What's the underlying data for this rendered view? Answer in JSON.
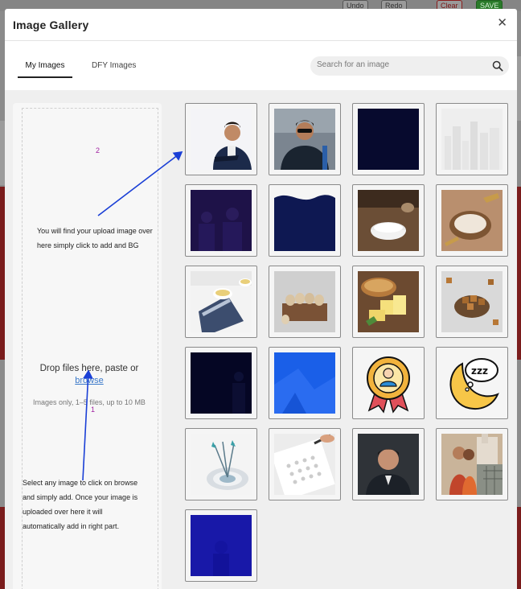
{
  "background": {
    "toolbar": {
      "undo": "Undo",
      "redo": "Redo",
      "clear": "Clear",
      "save": "SAVE"
    }
  },
  "modal": {
    "title": "Image Gallery",
    "close_icon": "close-icon",
    "tabs": [
      {
        "label": "My Images",
        "active": true
      },
      {
        "label": "DFY Images",
        "active": false
      }
    ],
    "search": {
      "placeholder": "Search for an image",
      "value": "",
      "icon": "search-icon"
    }
  },
  "upload": {
    "drop_text": "Drop files here, paste or",
    "browse_label": "browse",
    "hint": "Images only, 1–5 files, up to 10 MB"
  },
  "annotations": {
    "note_top": [
      "You will find your upload image over",
      "here simply click to add and BG"
    ],
    "note_bottom": [
      "Select any image to click on browse",
      "and simply add. Once your image is",
      "uploaded over here it will",
      "automatically add in right part."
    ],
    "marker_2": "2",
    "marker_1": "1"
  },
  "gallery": {
    "tiles": [
      {
        "id": "man-suit-cutout"
      },
      {
        "id": "man-jacket-sunglasses"
      },
      {
        "id": "dark-navy-square"
      },
      {
        "id": "city-skyline-faded"
      },
      {
        "id": "purple-crowd-overlay"
      },
      {
        "id": "navy-wave-shape"
      },
      {
        "id": "salt-bowl"
      },
      {
        "id": "flour-bowl-wheat"
      },
      {
        "id": "tea-cups-napkin"
      },
      {
        "id": "eggs-in-crate"
      },
      {
        "id": "bread-and-butter"
      },
      {
        "id": "brown-sugar-cubes"
      },
      {
        "id": "dark-crowd-silhouette"
      },
      {
        "id": "blue-abstract"
      },
      {
        "id": "employee-award-badge-icon"
      },
      {
        "id": "moon-zzz-sleep-icon"
      },
      {
        "id": "target-arrows"
      },
      {
        "id": "calendar-pen"
      },
      {
        "id": "businessman-portrait"
      },
      {
        "id": "couple-castle"
      },
      {
        "id": "blue-overlay-photo"
      }
    ]
  }
}
